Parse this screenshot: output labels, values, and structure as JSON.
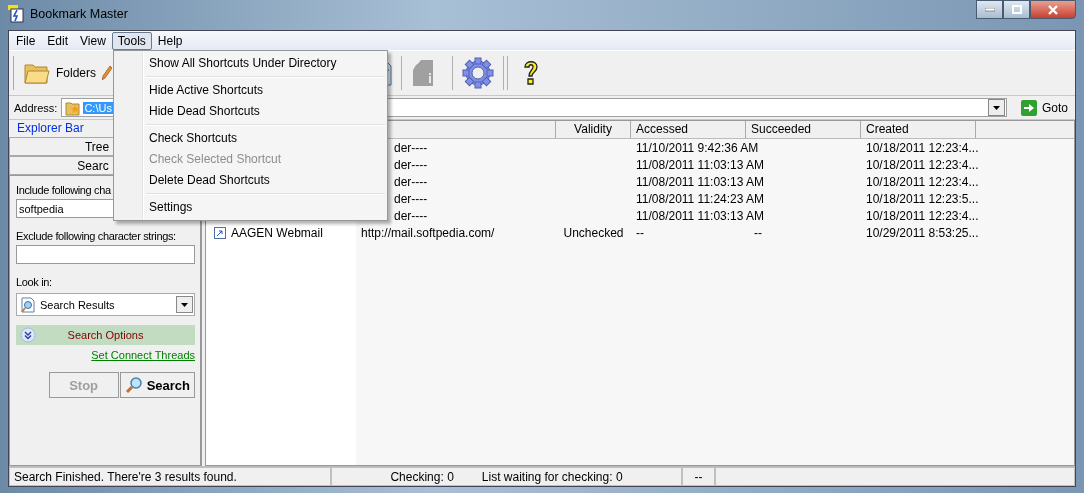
{
  "window": {
    "title": "Bookmark Master"
  },
  "menu_bar": [
    {
      "label": "File",
      "selected": false
    },
    {
      "label": "Edit",
      "selected": false
    },
    {
      "label": "View",
      "selected": false
    },
    {
      "label": "Tools",
      "selected": true
    },
    {
      "label": "Help",
      "selected": false
    }
  ],
  "tools_menu": [
    {
      "kind": "item",
      "label": "Show All Shortcuts Under Directory",
      "disabled": false
    },
    {
      "kind": "separator"
    },
    {
      "kind": "item",
      "label": "Hide Active Shortcuts",
      "disabled": false
    },
    {
      "kind": "item",
      "label": "Hide Dead Shortcuts",
      "disabled": false
    },
    {
      "kind": "separator"
    },
    {
      "kind": "item",
      "label": "Check Shortcuts",
      "disabled": false
    },
    {
      "kind": "item",
      "label": "Check Selected Shortcut",
      "disabled": true
    },
    {
      "kind": "item",
      "label": "Delete Dead Shortcuts",
      "disabled": false
    },
    {
      "kind": "separator"
    },
    {
      "kind": "item",
      "label": "Settings",
      "disabled": false
    }
  ],
  "toolbar": {
    "folders_button": "Folders"
  },
  "address": {
    "label": "Address:",
    "value": "C:\\Us",
    "goto": "Goto"
  },
  "explorer_bar": {
    "title": "Explorer Bar",
    "panel_buttons": [
      "Tree",
      "Searc"
    ]
  },
  "search_panel": {
    "include_label": "Include following cha",
    "include_value": "softpedia",
    "exclude_label": "Exclude following character strings:",
    "look_in_label": "Look in:",
    "look_in_value": "Search Results",
    "options": "Search Options",
    "link": "Set Connect Threads",
    "buttons": [
      {
        "kind": "stop",
        "label": "Stop",
        "disabled": true
      },
      {
        "kind": "search",
        "label": "Search",
        "disabled": false
      }
    ]
  },
  "table": {
    "columns": [
      "Validity",
      "Accessed",
      "Succeeded",
      "Created"
    ],
    "rows": [
      {
        "target": "der----",
        "accessed": "11/10/2011 9:42:36 AM",
        "created": "10/18/2011 12:23:4..."
      },
      {
        "target": "der----",
        "accessed": "11/08/2011 11:03:13 AM",
        "created": "10/18/2011 12:23:4..."
      },
      {
        "target": "der----",
        "accessed": "11/08/2011 11:03:13 AM",
        "created": "10/18/2011 12:23:4..."
      },
      {
        "target": "der----",
        "accessed": "11/08/2011 11:24:23 AM",
        "created": "10/18/2011 12:23:5..."
      },
      {
        "target": "der----",
        "accessed": "11/08/2011 11:03:13 AM",
        "created": "10/18/2011 12:23:4..."
      },
      {
        "name": "AAGEN Webmail",
        "target": "http://mail.softpedia.com/",
        "validity": "Unchecked",
        "accessed": "--",
        "succeeded": "--",
        "created": "10/29/2011 8:53:25..."
      }
    ]
  },
  "status_bar": {
    "message": "Search Finished. There're 3 results found.",
    "checking": "Checking: 0",
    "waiting": "List waiting for checking: 0",
    "extra": "--"
  }
}
